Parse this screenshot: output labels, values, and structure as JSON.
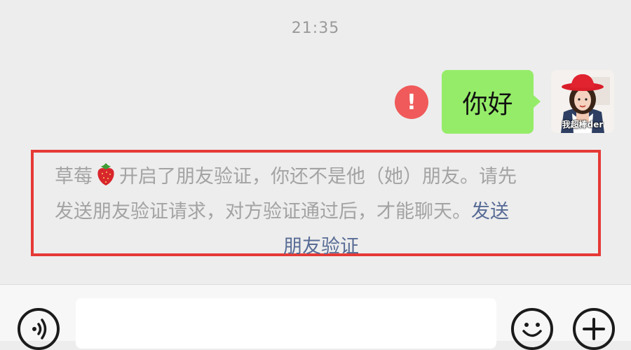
{
  "chat": {
    "timestamp": "21:35",
    "message": {
      "text": "你好",
      "status": "!",
      "avatar_caption": "我超棒der"
    },
    "notice": {
      "line1_prefix": "草莓",
      "line1_suffix": "开启了朋友验证，你还不是他（她）朋友。请先",
      "line2": "发送朋友验证请求，对方验证通过后，才能聊天。",
      "link_part1": "发送",
      "link_part2": "朋友验证",
      "emoji_icon": "strawberry-icon"
    }
  },
  "input_bar": {
    "voice_icon": "voice-icon",
    "emoji_icon": "smiley-icon",
    "plus_icon": "plus-icon",
    "value": ""
  },
  "colors": {
    "background": "#ededed",
    "bubble": "#95ec69",
    "alert": "#f05a5a",
    "highlight_border": "#e53a36",
    "link": "#576b95",
    "notice_text": "#a3a3a3"
  }
}
